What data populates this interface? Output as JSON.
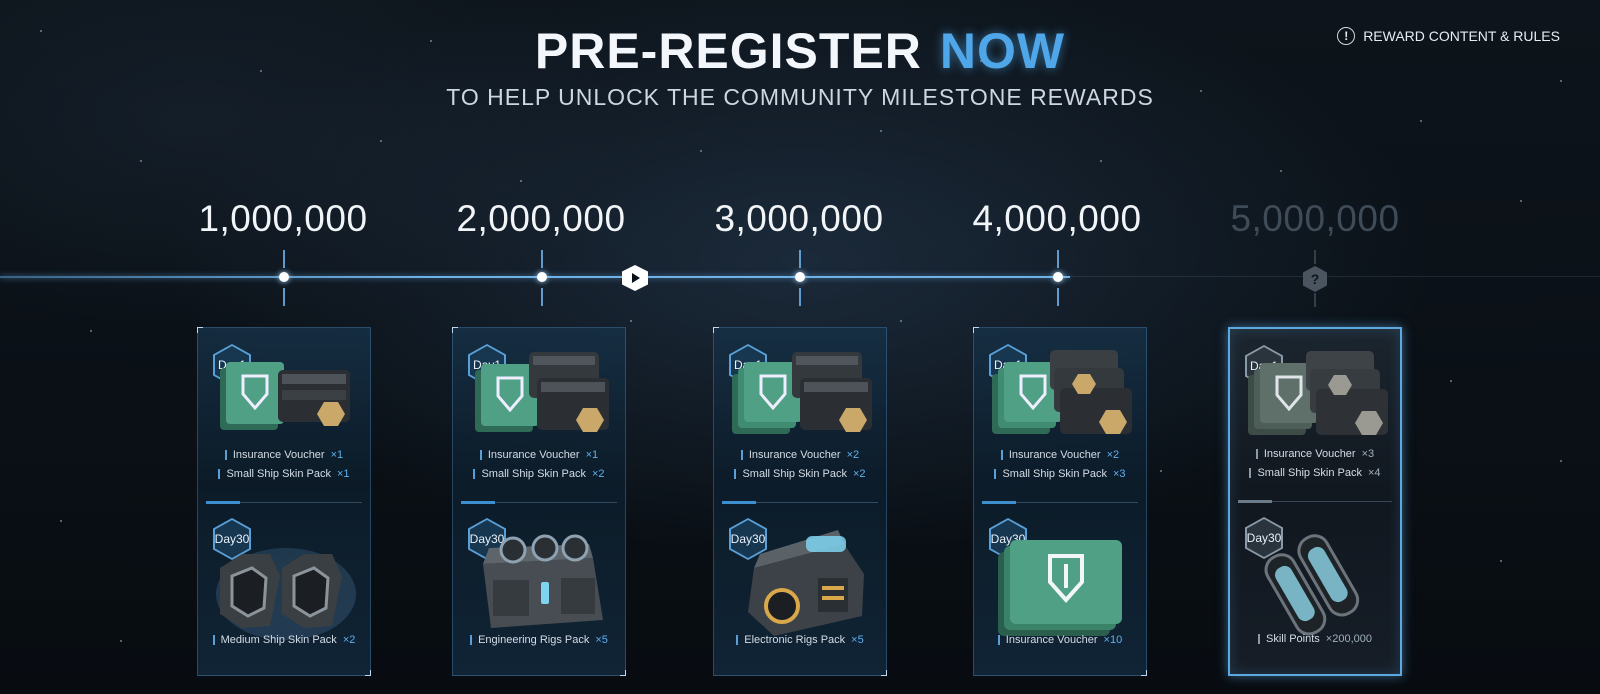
{
  "header": {
    "title_main": "PRE-REGISTER",
    "title_accent": "NOW",
    "subtitle": "TO HELP UNLOCK THE COMMUNITY MILESTONE REWARDS",
    "rules_link": "REWARD CONTENT & RULES"
  },
  "timeline": {
    "milestones": [
      "1,000,000",
      "2,000,000",
      "3,000,000",
      "4,000,000",
      "5,000,000"
    ],
    "locked_symbol": "?"
  },
  "cards": [
    {
      "day1_badge": "Day1",
      "day30_badge_line1": "Day",
      "day30_badge_line2": "30",
      "day1_rewards": [
        {
          "name": "Insurance Voucher",
          "qty": "×1"
        },
        {
          "name": "Small Ship Skin Pack",
          "qty": "×1"
        }
      ],
      "day30_reward": {
        "name": "Medium Ship Skin Pack",
        "qty": "×2"
      },
      "day1_art": "voucher-and-crate-icon",
      "day30_art": "twin-skin-crates-icon"
    },
    {
      "day1_badge": "Day1",
      "day30_badge_line1": "Day",
      "day30_badge_line2": "30",
      "day1_rewards": [
        {
          "name": "Insurance Voucher",
          "qty": "×1"
        },
        {
          "name": "Small Ship Skin Pack",
          "qty": "×2"
        }
      ],
      "day30_reward": {
        "name": "Engineering Rigs Pack",
        "qty": "×5"
      },
      "day1_art": "voucher-and-crates-icon",
      "day30_art": "engineering-rigs-chest-icon"
    },
    {
      "day1_badge": "Day1",
      "day30_badge_line1": "Day",
      "day30_badge_line2": "30",
      "day1_rewards": [
        {
          "name": "Insurance Voucher",
          "qty": "×2"
        },
        {
          "name": "Small Ship Skin Pack",
          "qty": "×2"
        }
      ],
      "day30_reward": {
        "name": "Electronic Rigs Pack",
        "qty": "×5"
      },
      "day1_art": "vouchers-and-crates-icon",
      "day30_art": "electronic-rigs-device-icon"
    },
    {
      "day1_badge": "Day1",
      "day30_badge_line1": "Day",
      "day30_badge_line2": "30",
      "day1_rewards": [
        {
          "name": "Insurance Voucher",
          "qty": "×2"
        },
        {
          "name": "Small Ship Skin Pack",
          "qty": "×3"
        }
      ],
      "day30_reward": {
        "name": "Insurance Voucher",
        "qty": "×10"
      },
      "day1_art": "vouchers-and-crates-icon",
      "day30_art": "voucher-stack-icon"
    },
    {
      "day1_badge": "Day1",
      "day30_badge_line1": "Day",
      "day30_badge_line2": "30",
      "day1_rewards": [
        {
          "name": "Insurance Voucher",
          "qty": "×3"
        },
        {
          "name": "Small Ship Skin Pack",
          "qty": "×4"
        }
      ],
      "day30_reward": {
        "name": "Skill Points",
        "qty": "×200,000"
      },
      "day1_art": "vouchers-and-crates-icon",
      "day30_art": "skill-injector-icon"
    }
  ],
  "colors": {
    "accent": "#4fa6e8",
    "qty": "#5fb0ee",
    "locked": "#3f4b57"
  }
}
